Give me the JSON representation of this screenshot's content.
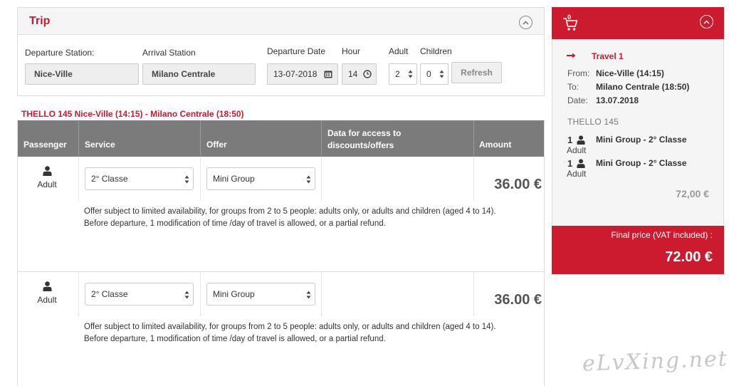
{
  "trip": {
    "title": "Trip",
    "departure_station_label": "Departure Station:",
    "departure_station_value": "Nice-Ville",
    "arrival_station_label": "Arrival Station",
    "arrival_station_value": "Milano Centrale",
    "departure_date_label": "Departure Date",
    "departure_date_value": "13-07-2018",
    "hour_label": "Hour",
    "hour_value": "14",
    "adult_label": "Adult",
    "adult_value": "2",
    "children_label": "Children",
    "children_value": "0",
    "refresh_label": "Refresh"
  },
  "train_line": "THELLO 145  Nice-Ville (14:15) - Milano Centrale (18:50)",
  "table": {
    "headers": {
      "passenger": "Passenger",
      "service": "Service",
      "offer": "Offer",
      "data_access_line1": "Data for access to",
      "data_access_line2": "discounts/offers",
      "amount": "Amount"
    },
    "rows": [
      {
        "passenger": "Adult",
        "service": "2° Classe",
        "offer": "Mini Group",
        "amount": "36.00 €",
        "note_line1": "Offer subject to limited availability, for groups from 2 to 5 people: adults only, or adults and children (aged 4 to 14).",
        "note_line2": "Before departure, 1 modification of time /day of travel is allowed, or a partial refund."
      },
      {
        "passenger": "Adult",
        "service": "2° Classe",
        "offer": "Mini Group",
        "amount": "36.00 €",
        "note_line1": "Offer subject to limited availability, for groups from 2 to 5 people: adults only, or adults and children (aged 4 to 14).",
        "note_line2": "Before departure, 1 modification of time /day of travel is allowed, or a partial refund."
      }
    ]
  },
  "cart": {
    "count": "0",
    "travel_title": "Travel 1",
    "from_label": "From:",
    "from_value": "Nice-Ville (14:15)",
    "to_label": "To:",
    "to_value": "Milano Centrale (18:50)",
    "date_label": "Date:",
    "date_value": "13.07.2018",
    "train": "THELLO  145",
    "items": [
      {
        "qty": "1",
        "who": "Adult",
        "desc": "Mini Group  -  2° Classe"
      },
      {
        "qty": "1",
        "who": "Adult",
        "desc": "Mini Group  -  2° Classe"
      }
    ],
    "subtotal": "72,00 €",
    "final_label": "Final price (VAT included) :",
    "final_price": "72.00 €"
  },
  "watermark": "eLvXing.net",
  "colors": {
    "accent": "#cc1a2f",
    "table_header": "#7b7b7b"
  }
}
